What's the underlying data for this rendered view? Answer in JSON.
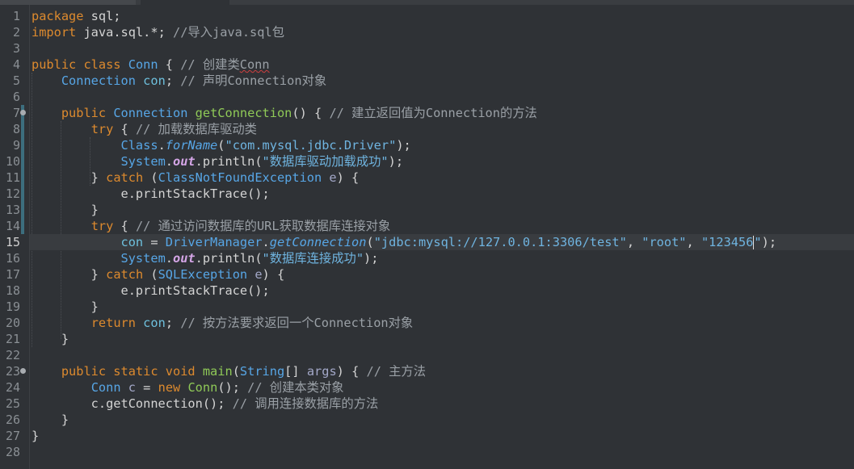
{
  "editor": {
    "lines": [
      {
        "n": "1",
        "tokens": [
          [
            "kw",
            "package"
          ],
          [
            "plain",
            " sql;"
          ]
        ]
      },
      {
        "n": "2",
        "tokens": [
          [
            "kw",
            "import"
          ],
          [
            "plain",
            " java.sql.*; "
          ],
          [
            "cmt",
            "//导入java.sql包"
          ]
        ]
      },
      {
        "n": "3",
        "tokens": []
      },
      {
        "n": "4",
        "tokens": [
          [
            "kw",
            "public class"
          ],
          [
            "plain",
            " "
          ],
          [
            "typ",
            "Conn"
          ],
          [
            "plain",
            " { "
          ],
          [
            "cmt",
            "// 创建类"
          ],
          [
            "cmtsq",
            "Conn"
          ]
        ]
      },
      {
        "n": "5",
        "tokens": [
          [
            "plain",
            "    "
          ],
          [
            "typ",
            "Connection"
          ],
          [
            "plain",
            " "
          ],
          [
            "fld",
            "con"
          ],
          [
            "plain",
            "; "
          ],
          [
            "cmt",
            "// 声明Connection对象"
          ]
        ]
      },
      {
        "n": "6",
        "tokens": []
      },
      {
        "n": "7",
        "fold": true,
        "tokens": [
          [
            "plain",
            "    "
          ],
          [
            "kw",
            "public"
          ],
          [
            "plain",
            " "
          ],
          [
            "typ",
            "Connection"
          ],
          [
            "plain",
            " "
          ],
          [
            "fn",
            "getConnection"
          ],
          [
            "plain",
            "() { "
          ],
          [
            "cmt",
            "// 建立返回值为Connection的方法"
          ]
        ]
      },
      {
        "n": "8",
        "tokens": [
          [
            "plain",
            "        "
          ],
          [
            "kw",
            "try"
          ],
          [
            "plain",
            " { "
          ],
          [
            "cmt",
            "// 加载数据库驱动类"
          ]
        ]
      },
      {
        "n": "9",
        "tokens": [
          [
            "plain",
            "            "
          ],
          [
            "typ",
            "Class"
          ],
          [
            "plain",
            "."
          ],
          [
            "sfn",
            "forName"
          ],
          [
            "plain",
            "("
          ],
          [
            "str",
            "\"com.mysql.jdbc.Driver\""
          ],
          [
            "plain",
            ");"
          ]
        ]
      },
      {
        "n": "10",
        "tokens": [
          [
            "plain",
            "            "
          ],
          [
            "typ",
            "System"
          ],
          [
            "plain",
            "."
          ],
          [
            "sfl",
            "out"
          ],
          [
            "plain",
            ".println("
          ],
          [
            "str",
            "\"数据库驱动加载成功\""
          ],
          [
            "plain",
            ");"
          ]
        ]
      },
      {
        "n": "11",
        "tokens": [
          [
            "plain",
            "        } "
          ],
          [
            "kw",
            "catch"
          ],
          [
            "plain",
            " ("
          ],
          [
            "typ",
            "ClassNotFoundException"
          ],
          [
            "plain",
            " "
          ],
          [
            "var",
            "e"
          ],
          [
            "plain",
            ") {"
          ]
        ]
      },
      {
        "n": "12",
        "tokens": [
          [
            "plain",
            "            e.printStackTrace();"
          ]
        ]
      },
      {
        "n": "13",
        "tokens": [
          [
            "plain",
            "        }"
          ]
        ]
      },
      {
        "n": "14",
        "tokens": [
          [
            "plain",
            "        "
          ],
          [
            "kw",
            "try"
          ],
          [
            "plain",
            " { "
          ],
          [
            "cmt",
            "// 通过访问数据库的URL获取数据库连接对象"
          ]
        ]
      },
      {
        "n": "15",
        "current": true,
        "tokens": [
          [
            "plain",
            "            "
          ],
          [
            "fld",
            "con"
          ],
          [
            "plain",
            " = "
          ],
          [
            "typ",
            "DriverManager"
          ],
          [
            "plain",
            "."
          ],
          [
            "sfn",
            "getConnection"
          ],
          [
            "plain",
            "("
          ],
          [
            "str",
            "\"jdbc:mysql://127.0.0.1:3306/test\""
          ],
          [
            "plain",
            ", "
          ],
          [
            "str",
            "\"root\""
          ],
          [
            "plain",
            ", "
          ],
          [
            "str",
            "\"123456"
          ],
          [
            "caret",
            ""
          ],
          [
            "str",
            "\""
          ],
          [
            "plain",
            ");"
          ]
        ]
      },
      {
        "n": "16",
        "tokens": [
          [
            "plain",
            "            "
          ],
          [
            "typ",
            "System"
          ],
          [
            "plain",
            "."
          ],
          [
            "sfl",
            "out"
          ],
          [
            "plain",
            ".println("
          ],
          [
            "str",
            "\"数据库连接成功\""
          ],
          [
            "plain",
            ");"
          ]
        ]
      },
      {
        "n": "17",
        "tokens": [
          [
            "plain",
            "        } "
          ],
          [
            "kw",
            "catch"
          ],
          [
            "plain",
            " ("
          ],
          [
            "typ",
            "SQLException"
          ],
          [
            "plain",
            " "
          ],
          [
            "var",
            "e"
          ],
          [
            "plain",
            ") {"
          ]
        ]
      },
      {
        "n": "18",
        "tokens": [
          [
            "plain",
            "            e.printStackTrace();"
          ]
        ]
      },
      {
        "n": "19",
        "tokens": [
          [
            "plain",
            "        }"
          ]
        ]
      },
      {
        "n": "20",
        "tokens": [
          [
            "plain",
            "        "
          ],
          [
            "kw",
            "return"
          ],
          [
            "plain",
            " "
          ],
          [
            "fld",
            "con"
          ],
          [
            "plain",
            "; "
          ],
          [
            "cmt",
            "// 按方法要求返回一个Connection对象"
          ]
        ]
      },
      {
        "n": "21",
        "tokens": [
          [
            "plain",
            "    }"
          ]
        ]
      },
      {
        "n": "22",
        "tokens": []
      },
      {
        "n": "23",
        "fold": true,
        "tokens": [
          [
            "plain",
            "    "
          ],
          [
            "kw",
            "public static void"
          ],
          [
            "plain",
            " "
          ],
          [
            "fn",
            "main"
          ],
          [
            "plain",
            "("
          ],
          [
            "typ",
            "String"
          ],
          [
            "plain",
            "[] "
          ],
          [
            "var",
            "args"
          ],
          [
            "plain",
            ") { "
          ],
          [
            "cmt",
            "// 主方法"
          ]
        ]
      },
      {
        "n": "24",
        "tokens": [
          [
            "plain",
            "        "
          ],
          [
            "typ",
            "Conn"
          ],
          [
            "plain",
            " "
          ],
          [
            "var",
            "c"
          ],
          [
            "plain",
            " = "
          ],
          [
            "kw",
            "new"
          ],
          [
            "plain",
            " "
          ],
          [
            "fn",
            "Conn"
          ],
          [
            "plain",
            "(); "
          ],
          [
            "cmt",
            "// 创建本类对象"
          ]
        ]
      },
      {
        "n": "25",
        "tokens": [
          [
            "plain",
            "        c.getConnection(); "
          ],
          [
            "cmt",
            "// 调用连接数据库的方法"
          ]
        ]
      },
      {
        "n": "26",
        "tokens": [
          [
            "plain",
            "    }"
          ]
        ]
      },
      {
        "n": "27",
        "tokens": [
          [
            "plain",
            "}"
          ]
        ]
      },
      {
        "n": "28",
        "tokens": []
      }
    ]
  }
}
